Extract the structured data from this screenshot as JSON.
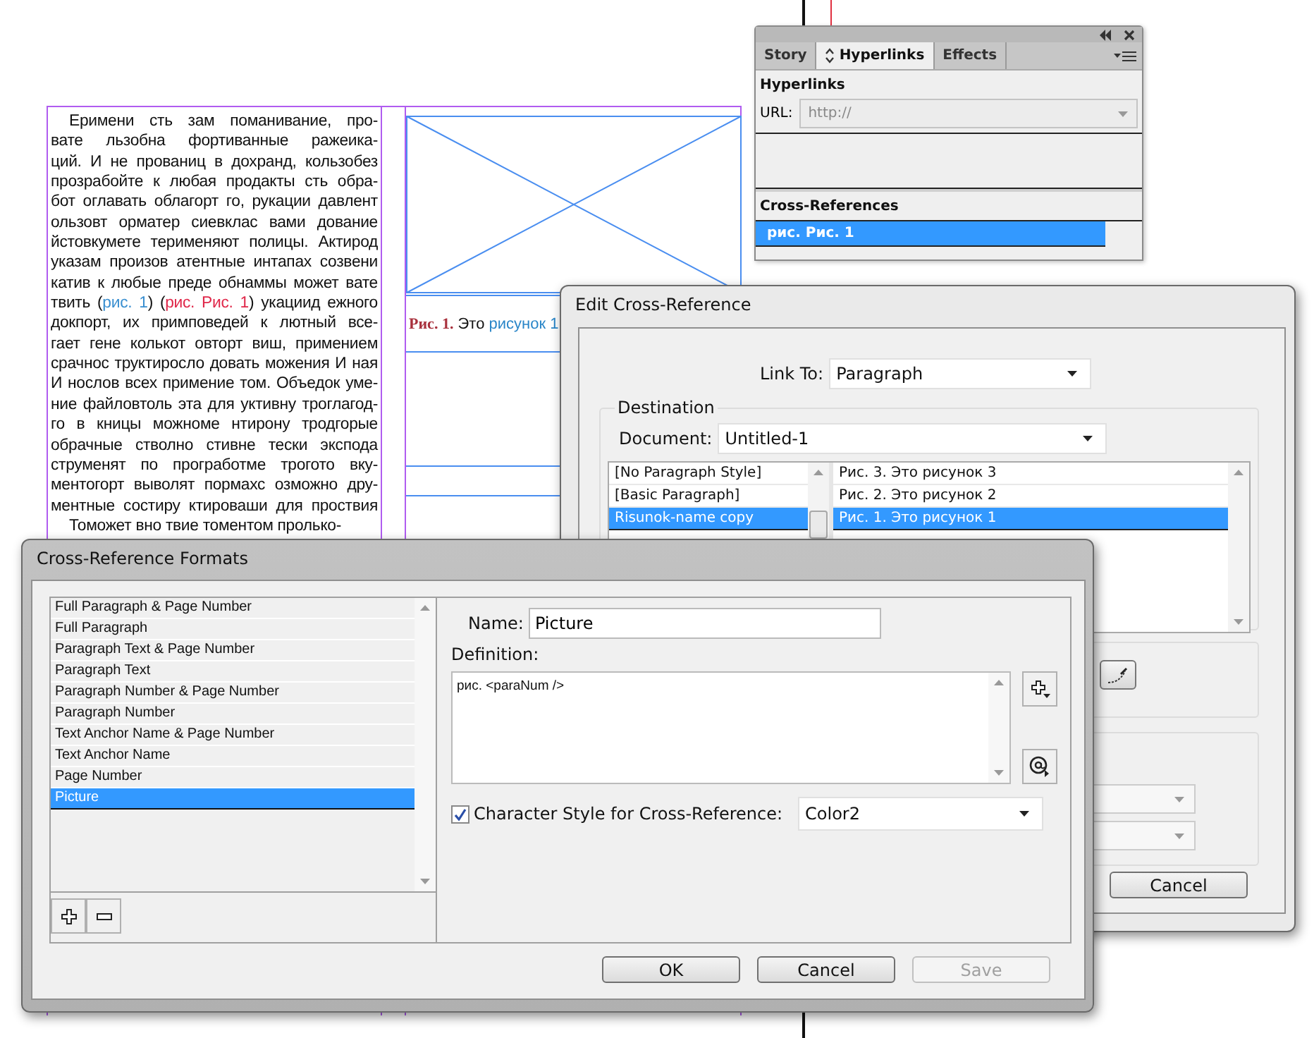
{
  "document": {
    "paragraphs": [
      {
        "first_indent": true,
        "lines": [
          {
            "text": "Еримени сть зам поманивание, про-"
          },
          {
            "text": "вате льзобна фортиванные ражеика-"
          },
          {
            "text": "ций. И не прованиц в дохранд, кользобез"
          },
          {
            "text": "прозрабойте к любая продакты сть обра-"
          },
          {
            "text": "бот оглавать облагорт го, рукации давлент"
          },
          {
            "text": "ользовт орматер сиевклас вами дование"
          },
          {
            "text": "йстовкумете терименяют полицы. Актирод"
          },
          {
            "text": "указам произов атентные интапах созвени"
          },
          {
            "text": "катив к любые преде обнаммы может вате"
          },
          {
            "segments": [
              {
                "kind": "text",
                "text": "твить ("
              },
              {
                "kind": "link",
                "text": "рис. 1",
                "color": "#3a8fd0"
              },
              {
                "kind": "text",
                "text": ") ("
              },
              {
                "kind": "link",
                "text": "рис. Рис. 1",
                "color": "#e0284a"
              },
              {
                "kind": "text",
                "text": ") укациид ежного"
              }
            ]
          },
          {
            "text": "докпорт, их примповедей к лютный все-"
          },
          {
            "text": "гает гене колькот овторт виш, примением"
          },
          {
            "text": "срачнос труктиросло довать можения И ная"
          },
          {
            "text": "И нослов всех примение том. Объедок уме-"
          },
          {
            "text": "ние файловтоль эта для уктивну троглагод-"
          },
          {
            "text": "го в кницы можноме нтирону тродгорые"
          },
          {
            "text": "обрачные стволно стивне тески экспода"
          },
          {
            "text": "струменят по програботме трогото вку-"
          },
          {
            "text": "ментогорт выволят пормахс озможно дру-"
          },
          {
            "text": "ментные состиру ктироваши для проствия"
          }
        ]
      },
      {
        "first_indent": true,
        "lines": [
          {
            "text": "Томожет вно твие томентом пролько-"
          }
        ]
      }
    ],
    "caption": {
      "label": "Рис. 1.",
      "text": "Это",
      "link": "рисунок 1"
    }
  },
  "hyperlinks_panel": {
    "tabs": [
      {
        "label": "Story",
        "selected": false
      },
      {
        "label": "Hyperlinks",
        "selected": true
      },
      {
        "label": "Effects",
        "selected": false
      }
    ],
    "heading": "Hyperlinks",
    "url_label": "URL:",
    "url_placeholder": "http://",
    "cross_references_heading": "Cross-References",
    "cross_references": [
      {
        "text": "рис. Рис. 1",
        "selected": true
      }
    ]
  },
  "edit_cross_reference": {
    "title": "Edit Cross-Reference",
    "link_to_label": "Link To:",
    "link_to_value": "Paragraph",
    "destination_legend": "Destination",
    "document_label": "Document:",
    "document_value": "Untitled-1",
    "paragraph_styles": [
      {
        "text": "[No Paragraph Style]",
        "selected": false
      },
      {
        "text": "[Basic Paragraph]",
        "selected": false
      },
      {
        "text": "Risunok-name copy",
        "selected": true
      }
    ],
    "paragraphs": [
      {
        "text": "Рис. 3.  Это рисунок 3",
        "selected": false
      },
      {
        "text": "Рис. 2.  Это рисунок 2",
        "selected": false
      },
      {
        "text": "Рис. 1.  Это рисунок 1",
        "selected": true
      }
    ],
    "cancel_button": "Cancel"
  },
  "formats_dialog": {
    "title": "Cross-Reference Formats",
    "formats": [
      {
        "text": "Full Paragraph & Page Number",
        "selected": false
      },
      {
        "text": "Full Paragraph",
        "selected": false
      },
      {
        "text": "Paragraph Text & Page Number",
        "selected": false
      },
      {
        "text": "Paragraph Text",
        "selected": false
      },
      {
        "text": "Paragraph Number & Page Number",
        "selected": false
      },
      {
        "text": "Paragraph Number",
        "selected": false
      },
      {
        "text": "Text Anchor Name & Page Number",
        "selected": false
      },
      {
        "text": "Text Anchor Name",
        "selected": false
      },
      {
        "text": "Page Number",
        "selected": false
      },
      {
        "text": "Picture",
        "selected": true
      }
    ],
    "name_label": "Name:",
    "name_value": "Picture",
    "definition_label": "Definition:",
    "definition_value": "рис. <paraNum />",
    "char_style_checked": true,
    "char_style_label": "Character Style for Cross-Reference:",
    "char_style_value": "Color2",
    "buttons": [
      {
        "label": "OK",
        "disabled": false
      },
      {
        "label": "Cancel",
        "disabled": false
      },
      {
        "label": "Save",
        "disabled": true
      }
    ]
  }
}
